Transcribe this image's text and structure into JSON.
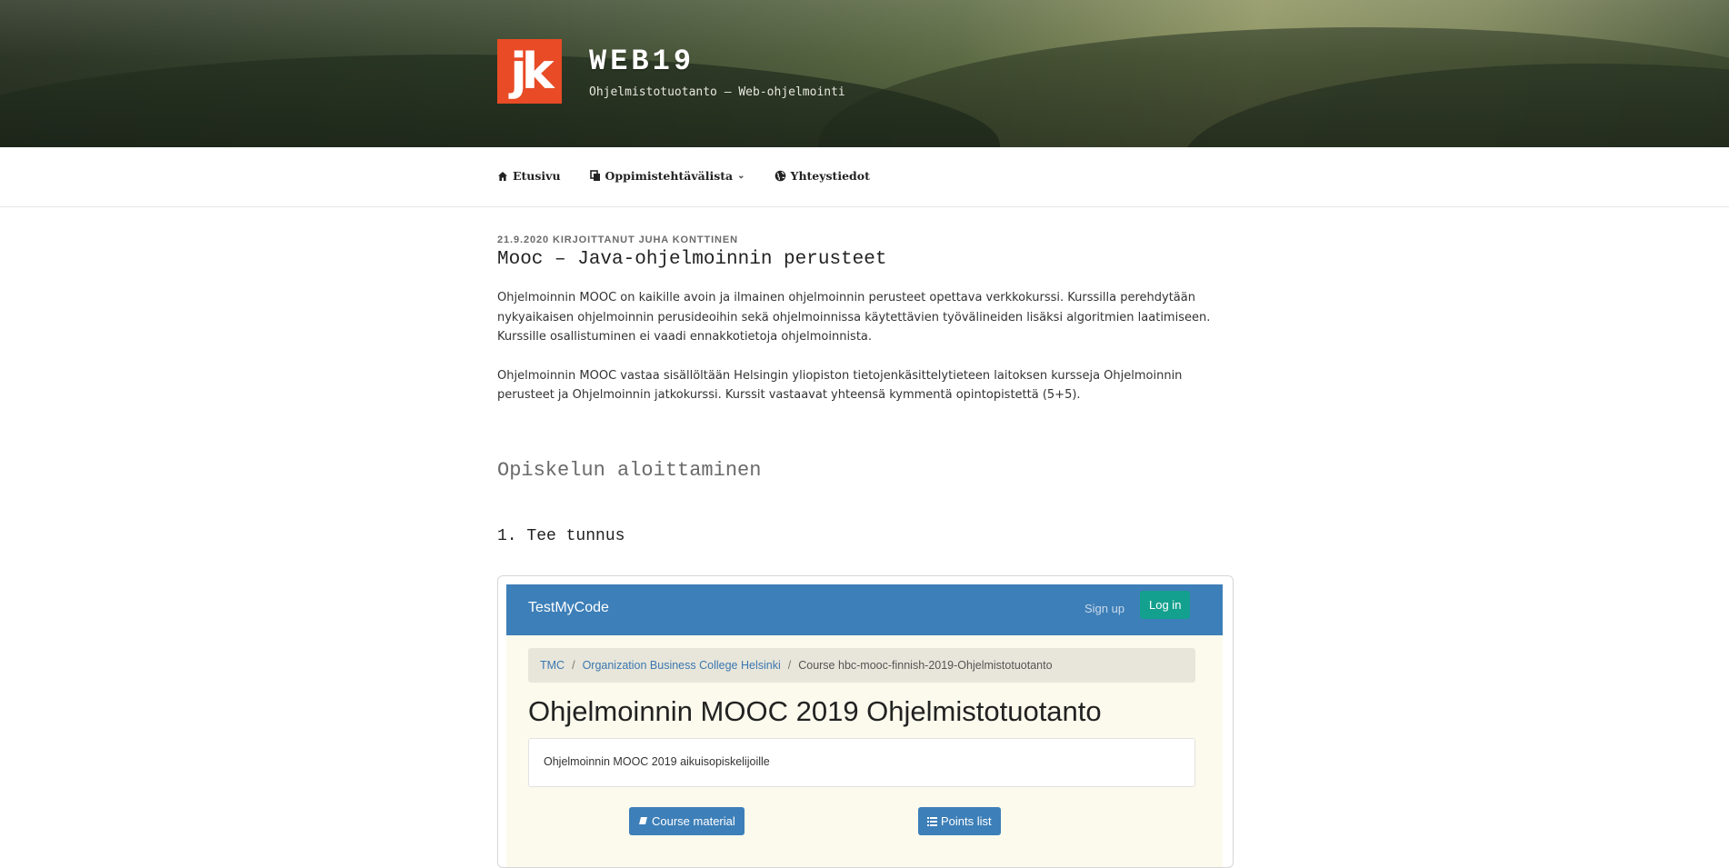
{
  "site": {
    "logo_text": "jk",
    "title": "WEB19",
    "description": "Ohjelmistotuotanto – Web-ohjelmointi"
  },
  "nav": {
    "items": [
      {
        "label": "Etusivu",
        "icon": "home-icon"
      },
      {
        "label": "Oppimistehtävälista",
        "icon": "copy-icon",
        "has_dropdown": true
      },
      {
        "label": "Yhteystiedot",
        "icon": "globe-icon"
      }
    ]
  },
  "post": {
    "meta": "21.9.2020 KIRJOITTANUT JUHA KONTTINEN",
    "title": "Mooc – Java-ohjelmoinnin perusteet",
    "paragraphs": [
      "Ohjelmoinnin MOOC on kaikille avoin ja ilmainen ohjelmoinnin perusteet opettava verkkokurssi. Kurssilla perehdytään nykyaikaisen ohjelmoinnin perusideoihin sekä ohjelmoinnissa käytettävien työvälineiden lisäksi algoritmien laatimiseen. Kurssille osallistuminen ei vaadi ennakkotietoja ohjelmoinnista.",
      "Ohjelmoinnin MOOC vastaa sisällöltään Helsingin yliopiston tietojenkäsittelytieteen laitoksen kursseja Ohjelmoinnin perusteet ja Ohjelmoinnin jatkokurssi. Kurssit vastaavat yhteensä kymmentä opintopistettä (5+5)."
    ],
    "heading2": "Opiskelun aloittaminen",
    "heading3": "1. Tee tunnus"
  },
  "screenshot": {
    "brand": "TestMyCode",
    "signup": "Sign up",
    "login": "Log in",
    "breadcrumb": [
      "TMC",
      "Organization Business College Helsinki",
      "Course hbc-mooc-finnish-2019-Ohjelmistotuotanto"
    ],
    "heading": "Ohjelmoinnin MOOC 2019 Ohjelmistotuotanto",
    "panel_text": "Ohjelmoinnin MOOC 2019 aikuisopiskelijoille",
    "button_material": "Course material",
    "button_points": "Points list"
  },
  "colors": {
    "logo": "#e84b26",
    "tmc_bar": "#3d7fb8",
    "tmc_login": "#14a08e"
  }
}
